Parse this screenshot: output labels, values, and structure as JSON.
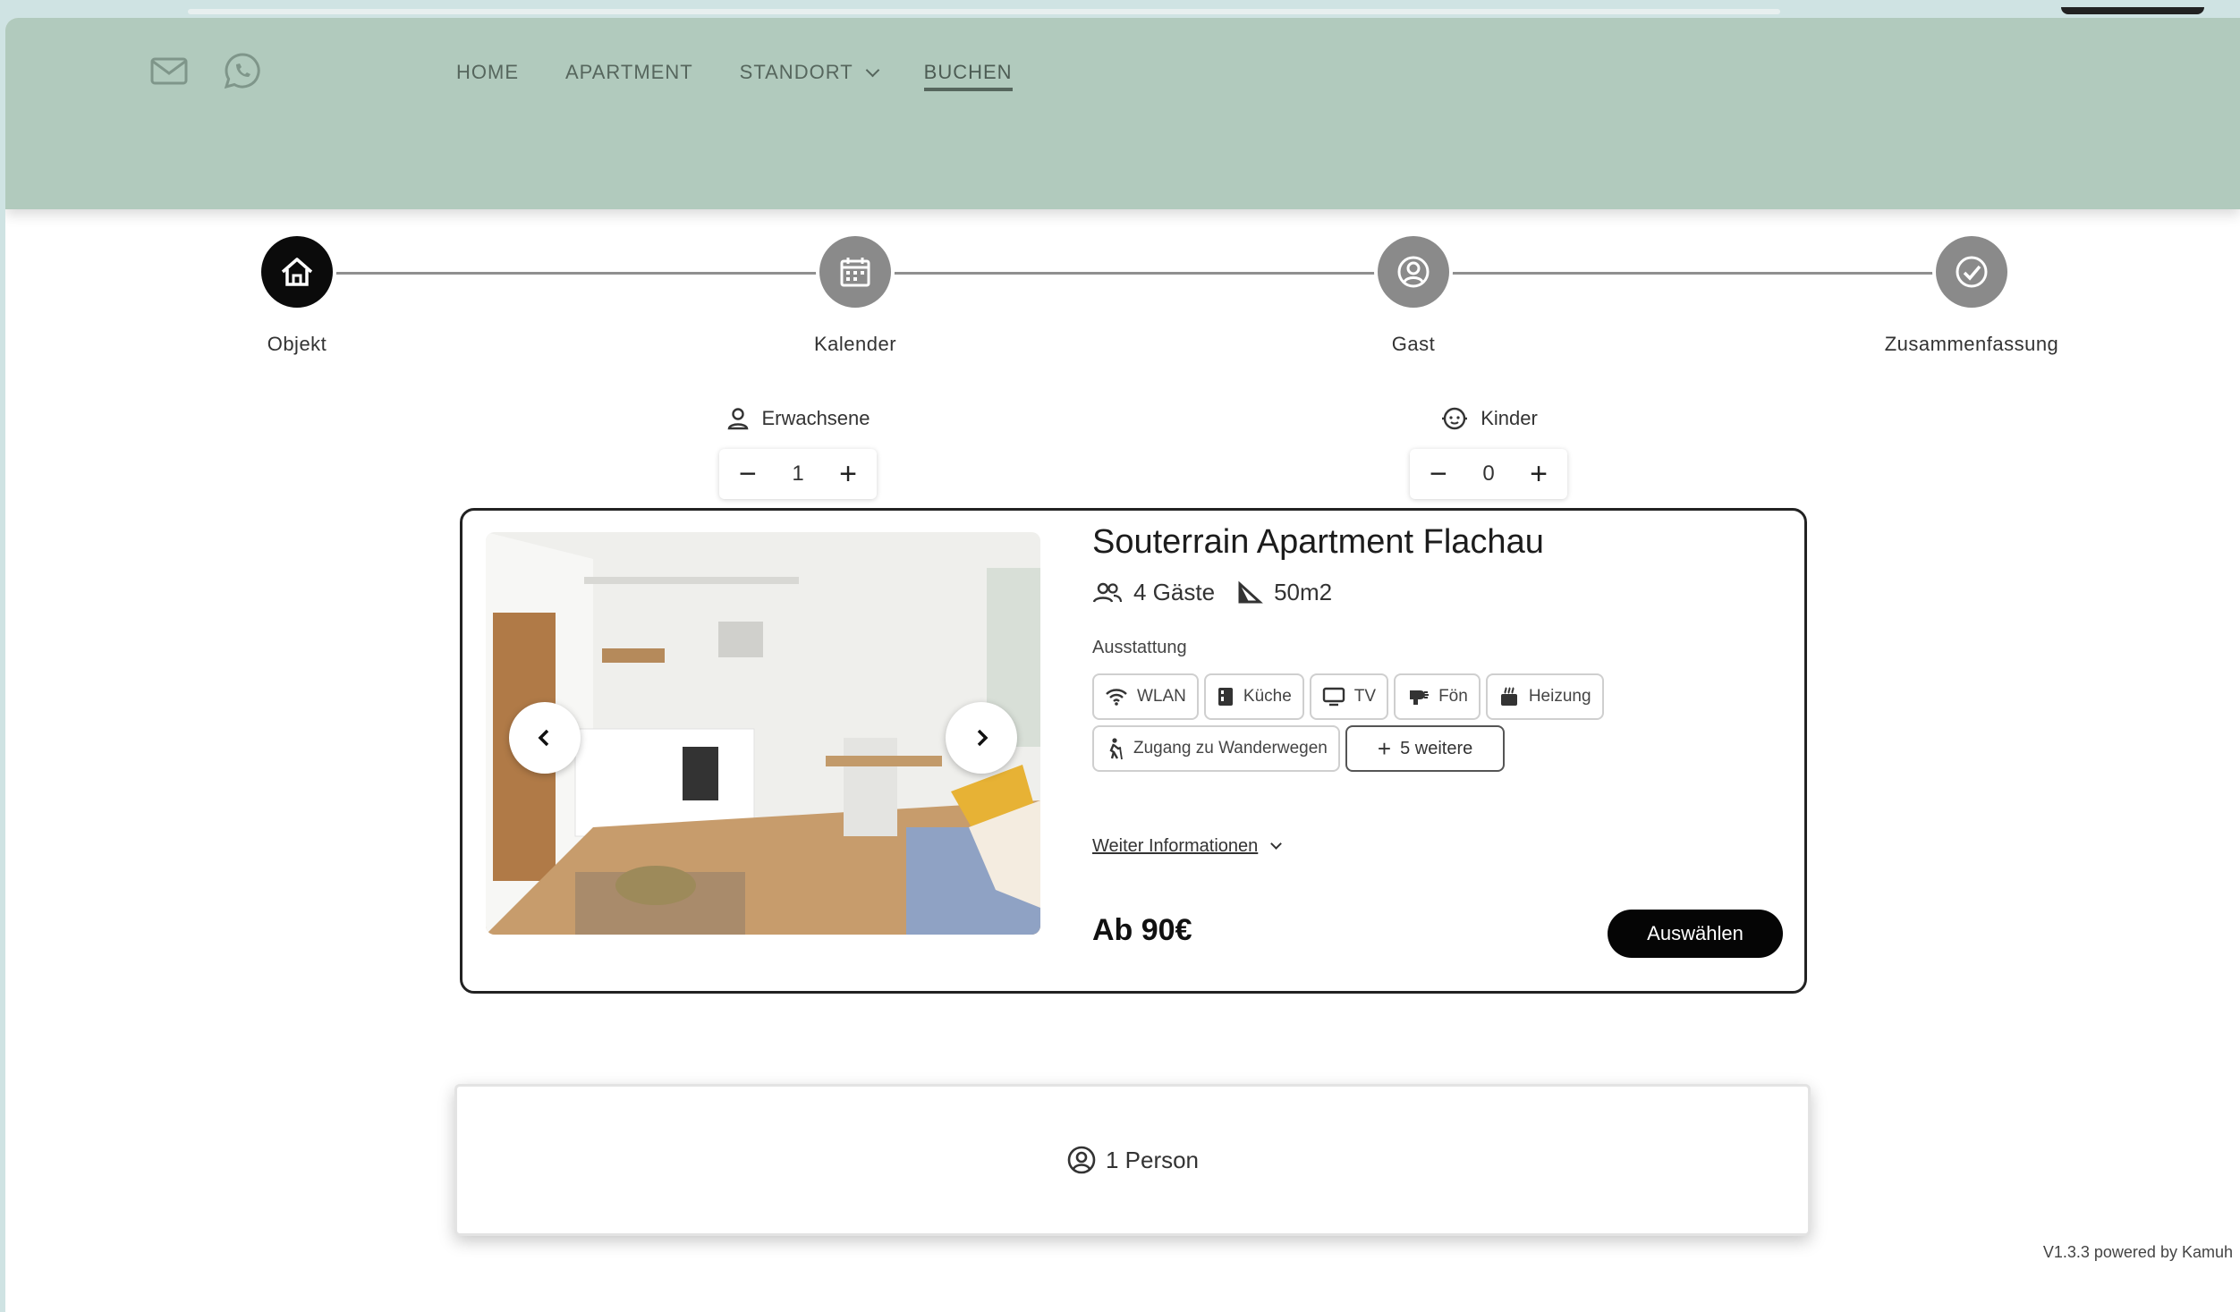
{
  "nav": {
    "items": [
      {
        "label": "HOME",
        "active": false
      },
      {
        "label": "APARTMENT",
        "active": false
      },
      {
        "label": "STANDORT",
        "active": false,
        "has_dropdown": true
      },
      {
        "label": "BUCHEN",
        "active": true
      }
    ],
    "icons": [
      "mail-icon",
      "whatsapp-icon"
    ]
  },
  "steps": [
    {
      "label": "Objekt",
      "icon": "home-icon",
      "active": true
    },
    {
      "label": "Kalender",
      "icon": "calendar-icon",
      "active": false
    },
    {
      "label": "Gast",
      "icon": "user-circle-icon",
      "active": false
    },
    {
      "label": "Zusammenfassung",
      "icon": "check-circle-icon",
      "active": false
    }
  ],
  "guests": {
    "adults": {
      "label": "Erwachsene",
      "value": "1"
    },
    "children": {
      "label": "Kinder",
      "value": "0"
    }
  },
  "listing": {
    "title": "Souterrain Apartment Flachau",
    "guests": "4 Gäste",
    "size": "50m2",
    "amenities_label": "Ausstattung",
    "amenities": [
      {
        "label": "WLAN",
        "icon": "wifi-icon"
      },
      {
        "label": "Küche",
        "icon": "kitchen-icon"
      },
      {
        "label": "TV",
        "icon": "tv-icon"
      },
      {
        "label": "Fön",
        "icon": "hairdryer-icon"
      },
      {
        "label": "Heizung",
        "icon": "heater-icon"
      },
      {
        "label": "Zugang zu Wanderwegen",
        "icon": "hiking-icon"
      }
    ],
    "more_amenities": "5 weitere",
    "more_info": "Weiter Informationen",
    "price": "Ab 90€",
    "select_button": "Auswählen"
  },
  "summary": {
    "text": "1 Person"
  },
  "version": "V1.3.3 powered by Kamuh",
  "colors": {
    "header": "#b1cabd",
    "active_step": "#0b0b0b",
    "inactive_step": "#8a8a8a",
    "button": "#050505"
  }
}
